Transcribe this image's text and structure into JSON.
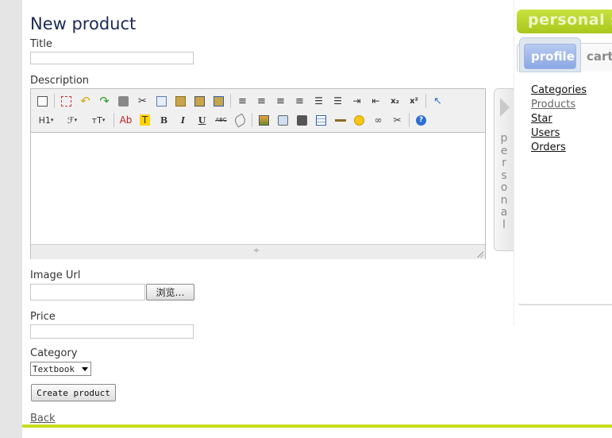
{
  "page": {
    "title": "New product"
  },
  "form": {
    "title_label": "Title",
    "title_value": "",
    "description_label": "Description",
    "image_url_label": "Image Url",
    "image_url_value": "",
    "browse_label": "浏览…",
    "price_label": "Price",
    "price_value": "",
    "category_label": "Category",
    "category_selected": "Textbook",
    "submit_label": "Create product"
  },
  "editor": {
    "row2_labels": {
      "heading": "H1",
      "font": "ℱ",
      "size": "ᴛT",
      "text_color": "Ab",
      "highlight": "T",
      "bold": "B",
      "italic": "I",
      "underline": "U",
      "strike": "ABC"
    },
    "resize_mark": "÷",
    "toolbar_icons_row1": [
      "source-icon",
      "fullscreen-icon",
      "undo-icon",
      "redo-icon",
      "print-icon",
      "cut-icon",
      "copy-icon",
      "paste-icon",
      "paste-text-icon",
      "paste-word-icon",
      "align-left-icon",
      "align-center-icon",
      "align-right-icon",
      "align-justify-icon",
      "ordered-list-icon",
      "unordered-list-icon",
      "indent-icon",
      "outdent-icon",
      "subscript-icon",
      "superscript-icon",
      "select-all-icon"
    ],
    "toolbar_icons_row2": [
      "heading-icon",
      "font-family-icon",
      "font-size-icon",
      "text-color-icon",
      "highlight-icon",
      "bold-icon",
      "italic-icon",
      "underline-icon",
      "strikethrough-icon",
      "eraser-icon",
      "image-icon",
      "flash-icon",
      "media-icon",
      "table-icon",
      "horizontal-rule-icon",
      "emoticon-icon",
      "link-icon",
      "unlink-icon",
      "help-icon"
    ]
  },
  "back_link": "Back",
  "sidebar": {
    "collapse_label": "personal",
    "banner_title": "personal s",
    "tabs": [
      "profile",
      "cart"
    ],
    "links": [
      "Categories",
      "Products",
      "Star",
      "Users",
      "Orders"
    ]
  },
  "colors": {
    "accent_green": "#c8dc1e",
    "title_navy": "#1c2a55",
    "tab_blue": "#8ba8e4"
  }
}
